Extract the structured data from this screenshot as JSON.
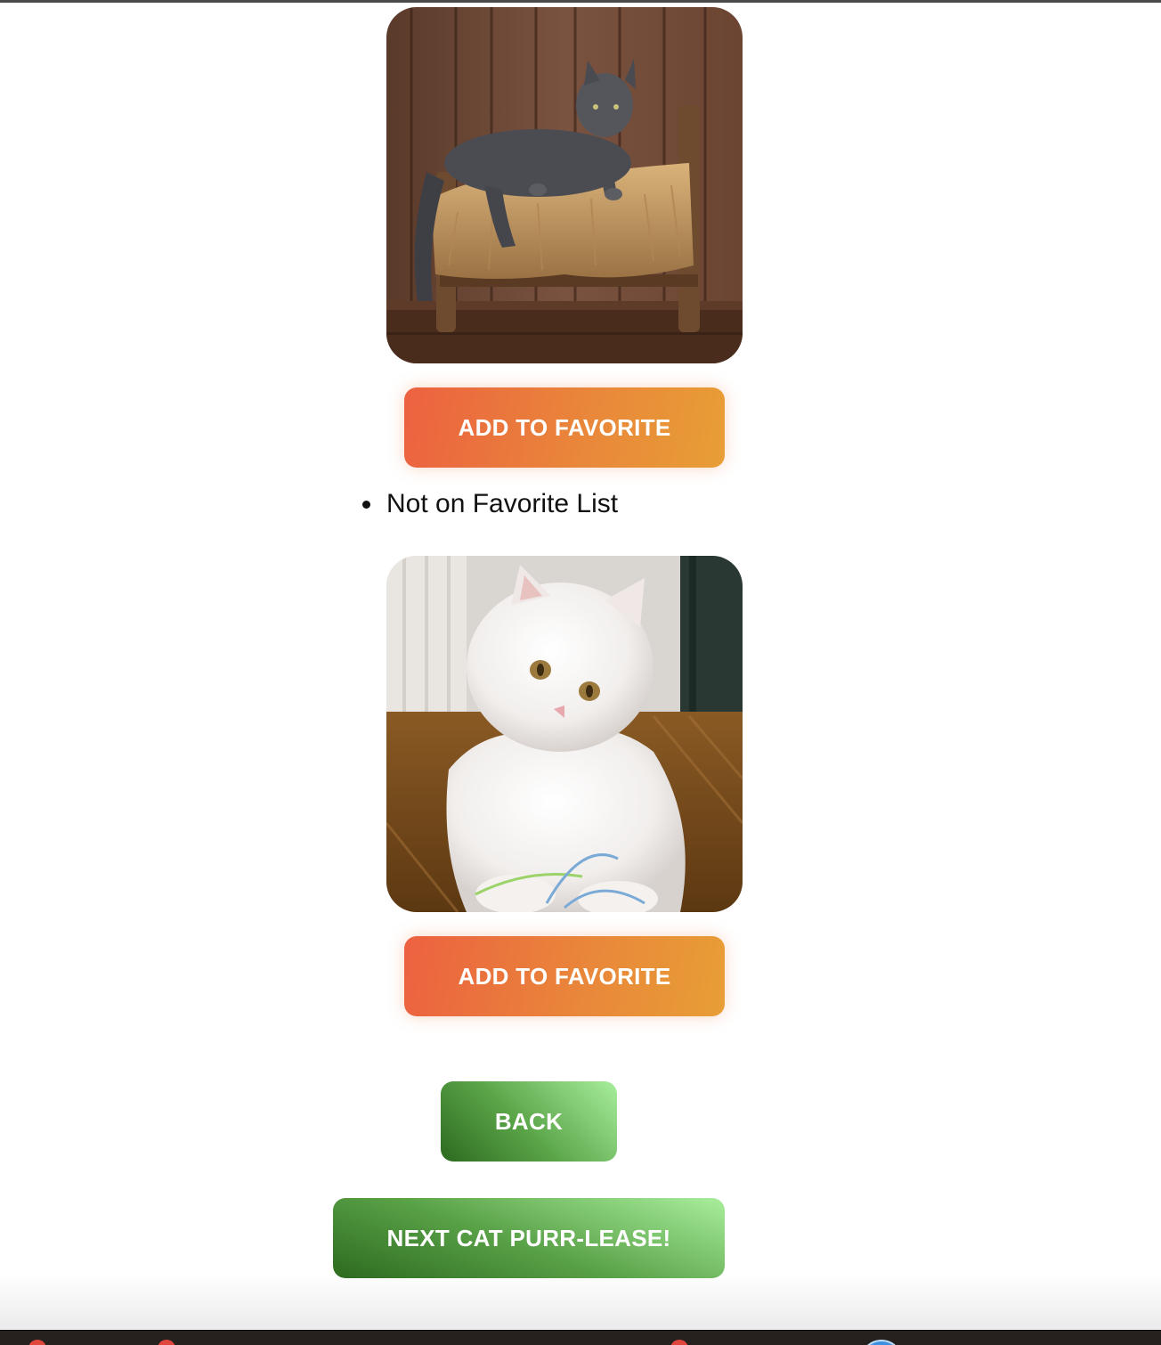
{
  "cards": [
    {
      "photo_alt": "Gray cat lying on a fur-covered wooden bed",
      "favorite_button": "ADD TO FAVORITE",
      "status_items": [
        "Not on Favorite List"
      ]
    },
    {
      "photo_alt": "White fluffy Persian cat on a wooden floor",
      "favorite_button": "ADD TO FAVORITE"
    }
  ],
  "navigation": {
    "back_label": "BACK",
    "next_label": "NEXT CAT PURR-LEASE!"
  },
  "colors": {
    "favorite_gradient": [
      "#ec6140",
      "#e89e36"
    ],
    "green_gradient": [
      "#2d6a1f",
      "#a8ee9c"
    ]
  }
}
